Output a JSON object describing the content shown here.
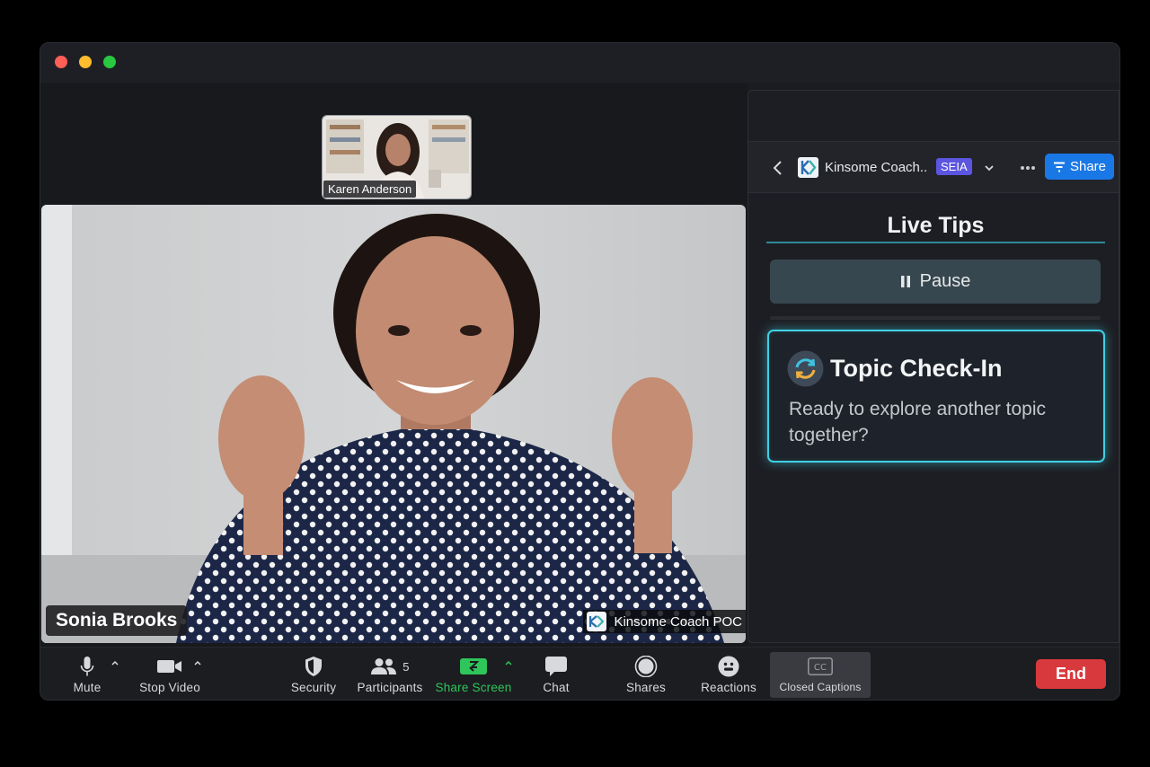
{
  "meeting": {
    "thumbnail_participant": "Karen Anderson",
    "active_speaker": "Sonia Brooks",
    "app_tag": "Kinsome Coach POC"
  },
  "panel": {
    "app_title": "Kinsome Coach..",
    "badge": "SEIA",
    "share_label": "Share",
    "section_title": "Live Tips",
    "pause_label": "Pause",
    "tip": {
      "title": "Topic Check-In",
      "body": "Ready to explore another topic together?"
    }
  },
  "toolbar": {
    "mute": "Mute",
    "stop_video": "Stop Video",
    "security": "Security",
    "participants": "Participants",
    "participants_count": "5",
    "share_screen": "Share Screen",
    "chat": "Chat",
    "shares": "Shares",
    "reactions": "Reactions",
    "closed_captions": "Closed Captions",
    "cc_glyph": "CC",
    "end": "End"
  },
  "icons": [
    "microphone-icon",
    "camera-icon",
    "shield-icon",
    "participants-icon",
    "share-screen-icon",
    "chat-icon",
    "shares-icon",
    "reactions-icon",
    "closed-captions-icon",
    "back-chevron-icon",
    "dropdown-chevron-icon",
    "more-icon",
    "share-icon",
    "pause-icon",
    "refresh-icon"
  ],
  "colors": {
    "accent_blue": "#1a78e6",
    "share_screen_green": "#2ec55a",
    "end_red": "#d8393d",
    "tip_border": "#3fd0e4",
    "badge_purple": "#5b55e0"
  }
}
